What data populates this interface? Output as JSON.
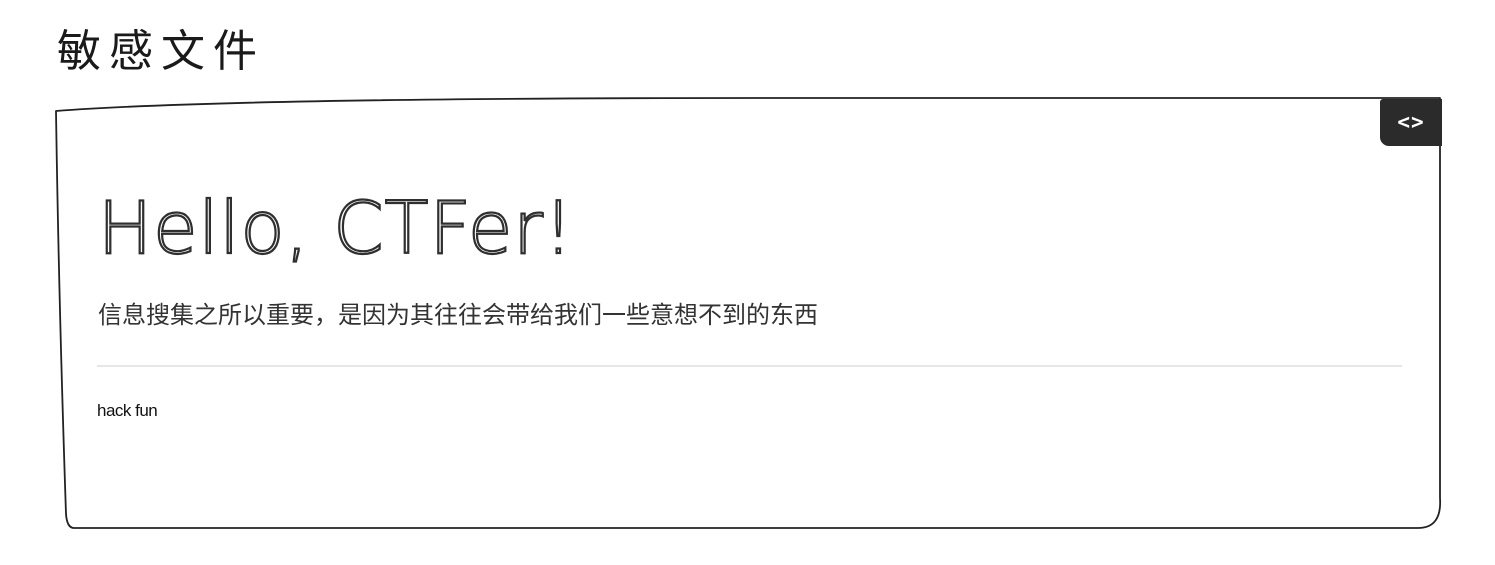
{
  "page": {
    "title": "敏感文件"
  },
  "toolbar": {
    "code_toggle_label": "<>"
  },
  "hero": {
    "heading": "Hello, CTFer!",
    "subtitle": "信息搜集之所以重要，是因为其往往会带给我们一些意想不到的东西"
  },
  "content": {
    "text": "hack fun"
  }
}
